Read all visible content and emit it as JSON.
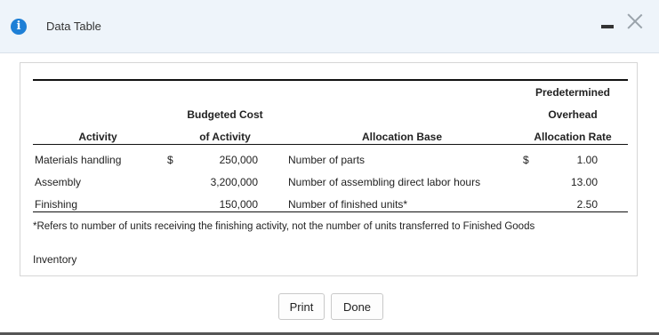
{
  "window": {
    "title": "Data Table"
  },
  "table": {
    "headers": {
      "activity": "Activity",
      "budgeted_cost_line1": "Budgeted Cost",
      "budgeted_cost_line2": "of Activity",
      "allocation_base": "Allocation Base",
      "rate_line1": "Predetermined",
      "rate_line2": "Overhead",
      "rate_line3": "Allocation Rate"
    },
    "rows": [
      {
        "activity": "Materials handling",
        "cost_symbol": "$",
        "cost": "250,000",
        "base": "Number of parts",
        "rate_symbol": "$",
        "rate": "1.00"
      },
      {
        "activity": "Assembly",
        "cost_symbol": "",
        "cost": "3,200,000",
        "base": "Number of assembling direct labor hours",
        "rate_symbol": "",
        "rate": "13.00"
      },
      {
        "activity": "Finishing",
        "cost_symbol": "",
        "cost": "150,000",
        "base": "Number of finished units*",
        "rate_symbol": "",
        "rate": "2.50"
      }
    ],
    "footnote": "*Refers to number of units receiving the finishing activity, not the number of units transferred to Finished Goods",
    "extra_text": "Inventory"
  },
  "buttons": {
    "print": "Print",
    "done": "Done"
  },
  "colors": {
    "titlebar": "#eef4fa",
    "info_icon": "#1e7fd6"
  }
}
